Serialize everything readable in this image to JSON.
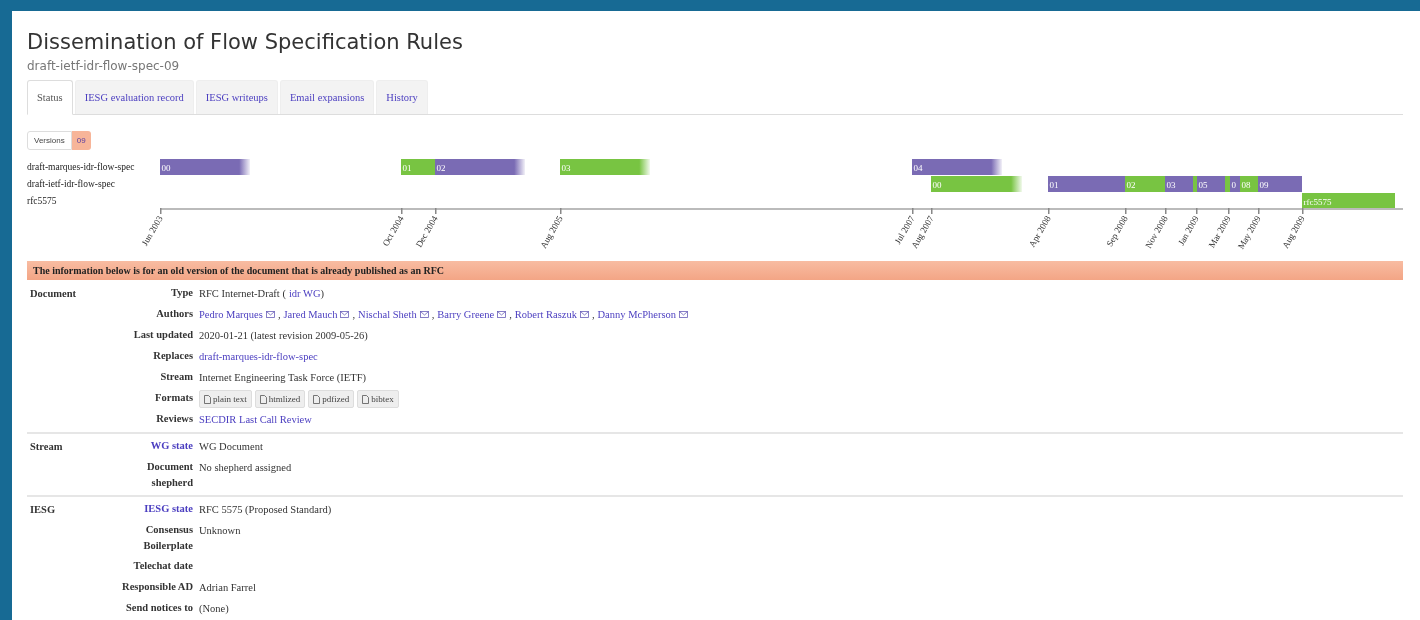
{
  "title": "Dissemination of Flow Specification Rules",
  "subtitle": "draft-ietf-idr-flow-spec-09",
  "tabs": [
    {
      "label": "Status",
      "selected": true
    },
    {
      "label": "IESG evaluation record",
      "selected": false
    },
    {
      "label": "IESG writeups",
      "selected": false
    },
    {
      "label": "Email expansions",
      "selected": false
    },
    {
      "label": "History",
      "selected": false
    }
  ],
  "versions": {
    "label": "Versions",
    "items": [
      {
        "label": "09",
        "selected": true
      }
    ]
  },
  "timeline": {
    "rows": [
      {
        "name": "draft-marques-idr-flow-spec",
        "segments": [
          {
            "label": "00",
            "color": "#7a6bb4",
            "expired": true
          },
          {
            "label": "01",
            "color": "#78c442",
            "expired": false
          },
          {
            "label": "02",
            "color": "#7a6bb4",
            "expired": true
          },
          {
            "label": "03",
            "color": "#78c442",
            "expired": true
          },
          {
            "label": "04",
            "color": "#7a6bb4",
            "expired": true
          }
        ]
      },
      {
        "name": "draft-ietf-idr-flow-spec",
        "segments": [
          {
            "label": "00",
            "color": "#78c442",
            "expired": true
          },
          {
            "label": "01",
            "color": "#7a6bb4",
            "expired": false
          },
          {
            "label": "02",
            "color": "#78c442",
            "expired": false
          },
          {
            "label": "03",
            "color": "#7a6bb4",
            "expired": false
          },
          {
            "color": "#78c442"
          },
          {
            "label": "05",
            "color": "#7a6bb4",
            "expired": false
          },
          {
            "color": "#78c442"
          },
          {
            "label": "0",
            "color": "#7a6bb4",
            "expired": false
          },
          {
            "label": "08",
            "color": "#78c442",
            "expired": false
          },
          {
            "label": "09",
            "color": "#7a6bb4",
            "expired": false
          }
        ]
      },
      {
        "name": "rfc5575",
        "segments": [
          {
            "label": "rfc5575",
            "color": "#78c442",
            "expired": false
          }
        ]
      }
    ],
    "ticks": [
      "Jun 2003",
      "Oct 2004",
      "Dec 2004",
      "Aug 2005",
      "Jul 2007",
      "Aug 2007",
      "Apr 2008",
      "Sep 2008",
      "Nov 2008",
      "Jan 2009",
      "Mar 2009",
      "May 2009",
      "Aug 2009"
    ]
  },
  "banner": "The information below is for an old version of the document that is already published as an RFC",
  "sections": [
    {
      "name": "Document",
      "rows": [
        {
          "label": "Type",
          "label_link": false,
          "parts": [
            {
              "kind": "text",
              "text": "RFC Internet-Draft ("
            },
            {
              "kind": "link",
              "text": "idr WG"
            },
            {
              "kind": "text",
              "text": ")"
            }
          ]
        },
        {
          "label": "Authors",
          "label_link": false,
          "parts": [
            {
              "kind": "author",
              "text": "Pedro Marques"
            },
            {
              "kind": "text",
              "text": ","
            },
            {
              "kind": "author",
              "text": "Jared Mauch"
            },
            {
              "kind": "text",
              "text": ","
            },
            {
              "kind": "author",
              "text": "Nischal Sheth"
            },
            {
              "kind": "text",
              "text": ","
            },
            {
              "kind": "author",
              "text": "Barry Greene"
            },
            {
              "kind": "text",
              "text": ","
            },
            {
              "kind": "author",
              "text": "Robert Raszuk"
            },
            {
              "kind": "text",
              "text": ","
            },
            {
              "kind": "author",
              "text": "Danny McPherson"
            }
          ]
        },
        {
          "label": "Last updated",
          "label_link": false,
          "parts": [
            {
              "kind": "text",
              "text": "2020-01-21 (latest revision 2009-05-26)"
            }
          ]
        },
        {
          "label": "Replaces",
          "label_link": false,
          "parts": [
            {
              "kind": "link",
              "text": "draft-marques-idr-flow-spec"
            }
          ]
        },
        {
          "label": "Stream",
          "label_link": false,
          "parts": [
            {
              "kind": "text",
              "text": "Internet Engineering Task Force (IETF)"
            }
          ]
        },
        {
          "label": "Formats",
          "label_link": false,
          "parts": [
            {
              "kind": "format",
              "text": "plain text"
            },
            {
              "kind": "format",
              "text": "htmlized"
            },
            {
              "kind": "format",
              "text": "pdfized"
            },
            {
              "kind": "format",
              "text": "bibtex"
            }
          ]
        },
        {
          "label": "Reviews",
          "label_link": false,
          "parts": [
            {
              "kind": "link",
              "text": "SECDIR Last Call Review"
            }
          ]
        }
      ]
    },
    {
      "name": "Stream",
      "rows": [
        {
          "label": "WG state",
          "label_link": true,
          "parts": [
            {
              "kind": "text",
              "text": "WG Document"
            }
          ]
        },
        {
          "label": "Document shepherd",
          "label_link": false,
          "parts": [
            {
              "kind": "text",
              "text": "No shepherd assigned"
            }
          ]
        }
      ]
    },
    {
      "name": "IESG",
      "rows": [
        {
          "label": "IESG state",
          "label_link": true,
          "parts": [
            {
              "kind": "text",
              "text": "RFC 5575 (Proposed Standard)"
            }
          ]
        },
        {
          "label": "Consensus Boilerplate",
          "label_link": false,
          "parts": [
            {
              "kind": "text",
              "text": "Unknown"
            }
          ]
        },
        {
          "label": "Telechat date",
          "label_link": false,
          "parts": []
        },
        {
          "label": "Responsible AD",
          "label_link": false,
          "parts": [
            {
              "kind": "text",
              "text": "Adrian Farrel"
            }
          ]
        },
        {
          "label": "Send notices to",
          "label_link": false,
          "parts": [
            {
              "kind": "text",
              "text": "(None)"
            }
          ]
        }
      ]
    }
  ]
}
